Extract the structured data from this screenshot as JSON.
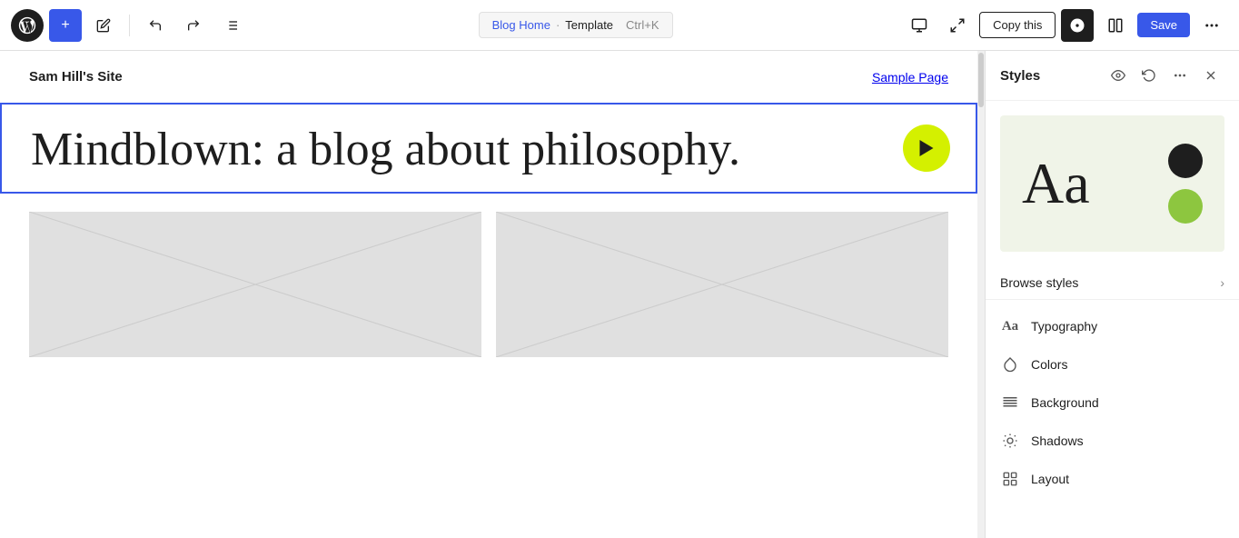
{
  "toolbar": {
    "add_label": "+",
    "undo_label": "↩",
    "redo_label": "↪",
    "list_label": "≡",
    "breadcrumb_link": "Blog Home",
    "breadcrumb_sep": "·",
    "breadcrumb_template": "Template",
    "breadcrumb_shortcut": "Ctrl+K",
    "copy_this_label": "Copy this",
    "save_label": "Save",
    "monitor_icon": "🖥",
    "expand_icon": "⤢",
    "dual_view_icon": "▣",
    "more_icon": "⋯"
  },
  "canvas": {
    "site_title": "Sam Hill's Site",
    "site_nav_label": "Sample Page",
    "hero_text": "Mindblown: a blog about philosophy."
  },
  "styles_panel": {
    "title": "Styles",
    "browse_styles_label": "Browse styles",
    "items": [
      {
        "id": "typography",
        "label": "Typography",
        "icon": "Aa"
      },
      {
        "id": "colors",
        "label": "Colors",
        "icon": "droplet"
      },
      {
        "id": "background",
        "label": "Background",
        "icon": "stripes"
      },
      {
        "id": "shadows",
        "label": "Shadows",
        "icon": "sun"
      },
      {
        "id": "layout",
        "label": "Layout",
        "icon": "grid"
      }
    ],
    "preview": {
      "aa_text": "Aa",
      "dot1_color": "#1e1e1e",
      "dot2_color": "#8dc63f",
      "bg_color": "#f0f4e8"
    }
  }
}
